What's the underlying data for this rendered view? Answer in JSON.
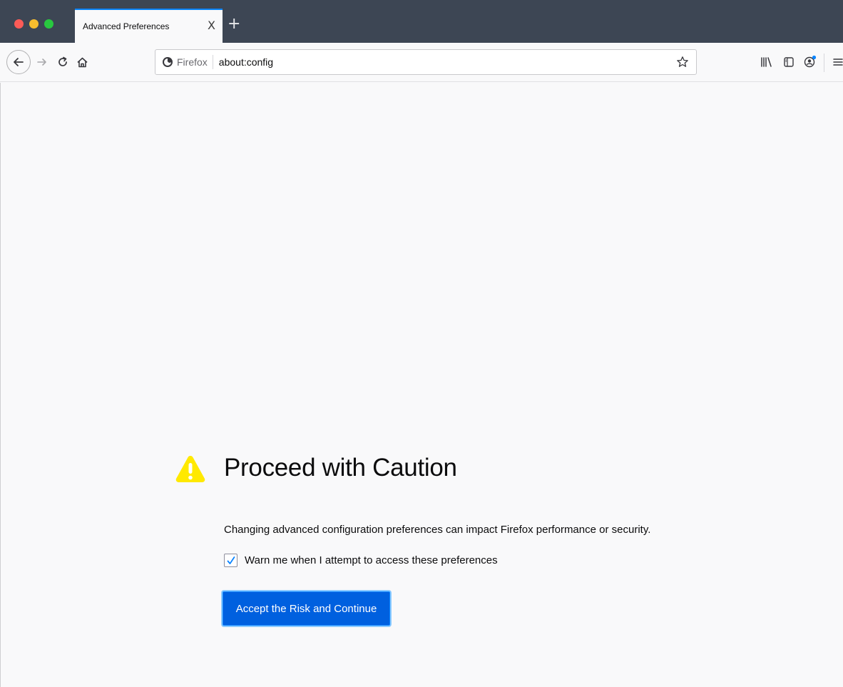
{
  "window": {
    "traffic_lights": [
      "close",
      "minimize",
      "zoom"
    ]
  },
  "tab": {
    "title": "Advanced Preferences",
    "close_label": "X",
    "new_tab_label": "+"
  },
  "toolbar": {
    "url_identity_label": "Firefox",
    "url": "about:config"
  },
  "page": {
    "title": "Proceed with Caution",
    "description": "Changing advanced configuration preferences can impact Firefox performance or security.",
    "checkbox_label": "Warn me when I attempt to access these preferences",
    "checkbox_checked": true,
    "button_label": "Accept the Risk and Continue"
  },
  "colors": {
    "accent": "#0060df",
    "warning": "#ffe900",
    "tabstrip": "#3d4654"
  },
  "icons": [
    "back-arrow-icon",
    "forward-arrow-icon",
    "reload-icon",
    "home-icon",
    "firefox-logo-icon",
    "bookmark-star-icon",
    "library-icon",
    "sidebar-icon",
    "account-icon",
    "hamburger-menu-icon",
    "warning-icon",
    "checkmark-icon"
  ]
}
